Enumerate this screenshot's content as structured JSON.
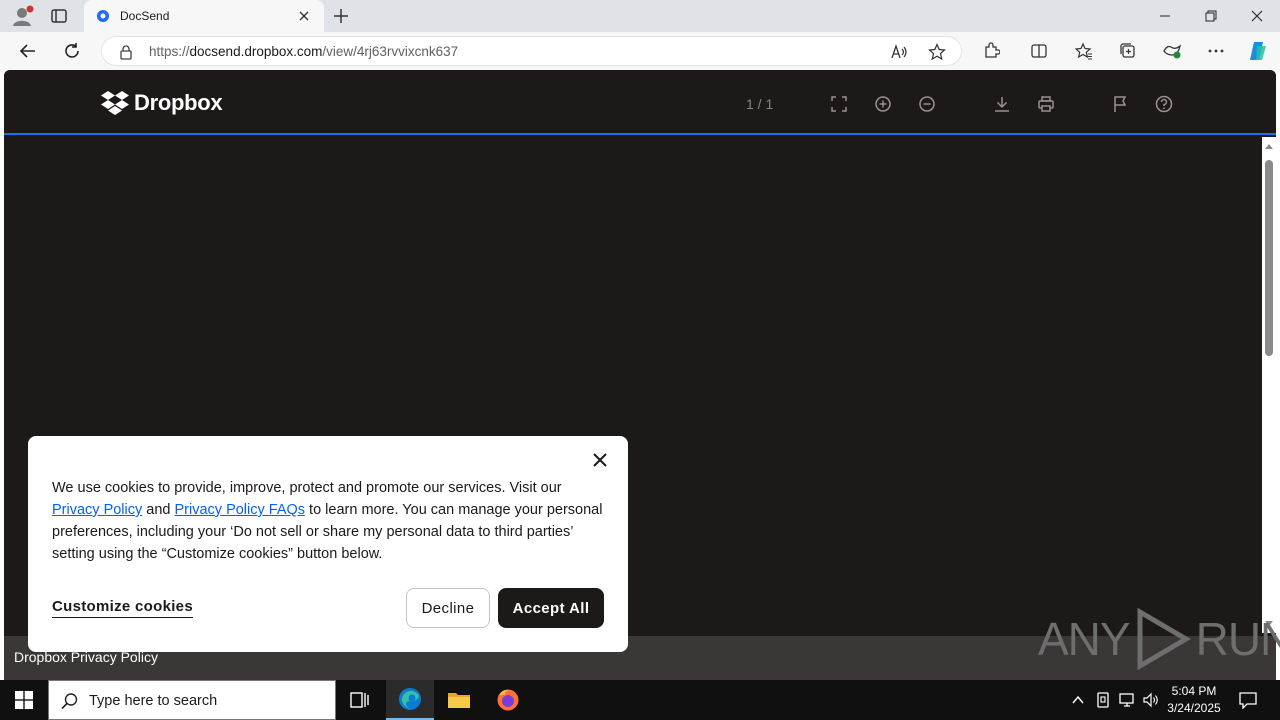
{
  "browser": {
    "tab_title": "DocSend",
    "url_prefix": "https://",
    "url_host": "docsend.dropbox.com",
    "url_path": "/view/4rj63rvvixcnk637"
  },
  "viewer": {
    "logo_text": "Dropbox",
    "page_counter": "1 / 1",
    "footer_link": "Dropbox Privacy Policy"
  },
  "cookie": {
    "text_1": "We use cookies to provide, improve, protect and promote our services. Visit our ",
    "privacy_policy_link": "Privacy Policy",
    "text_2": " and ",
    "faq_link": "Privacy Policy FAQs",
    "text_3": " to learn more. You can manage your personal preferences, including your ‘Do not sell or share my personal data to third parties’ setting using the “Customize cookies” button below.",
    "customize_label": "Customize cookies",
    "decline_label": "Decline",
    "accept_label": "Accept All"
  },
  "watermark": {
    "left": "ANY",
    "right": "RUN"
  },
  "taskbar": {
    "search_placeholder": "Type here to search",
    "time": "5:04 PM",
    "date": "3/24/2025"
  },
  "colors": {
    "accent": "#1f6df2",
    "viewer_bg": "#1c1918",
    "link": "#0061fe"
  }
}
